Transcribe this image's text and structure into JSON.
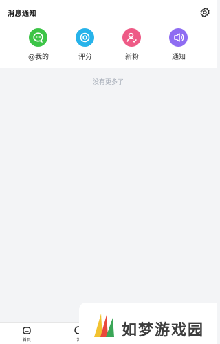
{
  "header": {
    "title": "消息通知"
  },
  "tabs": [
    {
      "label": "@我的",
      "icon": "chat-icon",
      "color": "#3cc447"
    },
    {
      "label": "评分",
      "icon": "target-icon",
      "color": "#27b3ea"
    },
    {
      "label": "新粉",
      "icon": "user-icon",
      "color": "#ee5a86"
    },
    {
      "label": "通知",
      "icon": "megaphone-icon",
      "color": "#8e6cf2"
    }
  ],
  "main": {
    "empty_text": "没有更多了"
  },
  "bottom_nav": [
    {
      "label": "首页",
      "icon": "home-icon"
    },
    {
      "label": "发",
      "icon": "circle-icon"
    }
  ],
  "watermark": {
    "brand": "如梦游戏园"
  }
}
